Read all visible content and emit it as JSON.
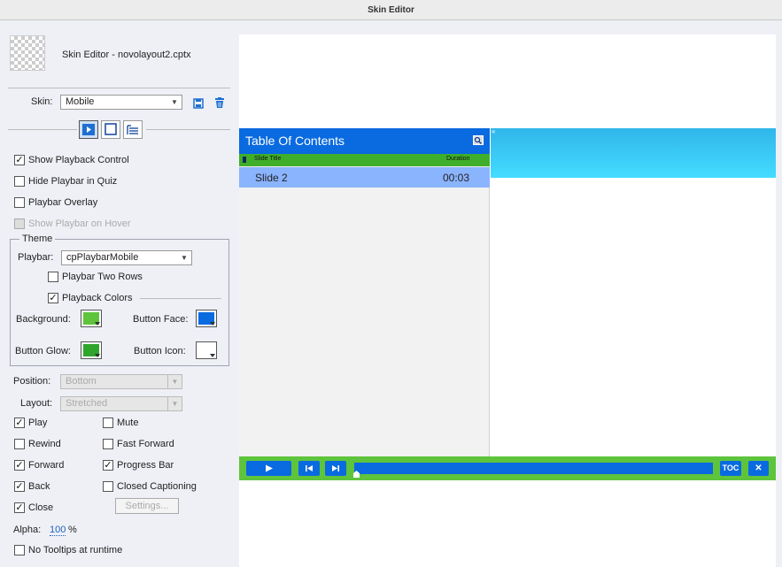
{
  "window": {
    "title": "Skin Editor"
  },
  "header": {
    "project_label": "Skin Editor - novolayout2.cptx"
  },
  "skin": {
    "label": "Skin:",
    "value": "Mobile"
  },
  "options": {
    "show_playback_control": "Show Playback Control",
    "hide_playbar_in_quiz": "Hide Playbar in Quiz",
    "playbar_overlay": "Playbar Overlay",
    "show_playbar_on_hover": "Show Playbar on Hover"
  },
  "theme": {
    "legend": "Theme",
    "playbar_label": "Playbar:",
    "playbar_value": "cpPlaybarMobile",
    "two_rows": "Playbar Two Rows",
    "playback_colors": "Playback Colors",
    "background_label": "Background:",
    "button_face_label": "Button Face:",
    "button_glow_label": "Button Glow:",
    "button_icon_label": "Button Icon:",
    "colors": {
      "background": "#5ec43c",
      "button_face": "#0a6ae0",
      "button_glow": "#2fa52c",
      "button_icon": "#ffffff"
    }
  },
  "position": {
    "label": "Position:",
    "value": "Bottom"
  },
  "layout": {
    "label": "Layout:",
    "value": "Stretched"
  },
  "controls": {
    "play": "Play",
    "mute": "Mute",
    "rewind": "Rewind",
    "fast_forward": "Fast Forward",
    "forward": "Forward",
    "progress_bar": "Progress Bar",
    "back": "Back",
    "closed_captioning": "Closed Captioning",
    "close": "Close",
    "settings": "Settings..."
  },
  "alpha": {
    "label": "Alpha:",
    "value": "100",
    "unit": "%"
  },
  "no_tooltips": "No Tooltips at runtime",
  "toc": {
    "title": "Table Of Contents",
    "col_title": "Slide Title",
    "col_duration": "Duration",
    "rows": [
      {
        "title": "Slide 2",
        "duration": "00:03"
      }
    ],
    "colors": {
      "header": "#0a6ae0",
      "column_bar": "#3fae2a",
      "selected_row": "#8bb4ff",
      "body": "#f2f2f2"
    }
  },
  "playbar": {
    "toc_label": "TOC",
    "close_label": "✕",
    "bar_color": "#5ec43c",
    "button_color": "#0a6ae0"
  }
}
